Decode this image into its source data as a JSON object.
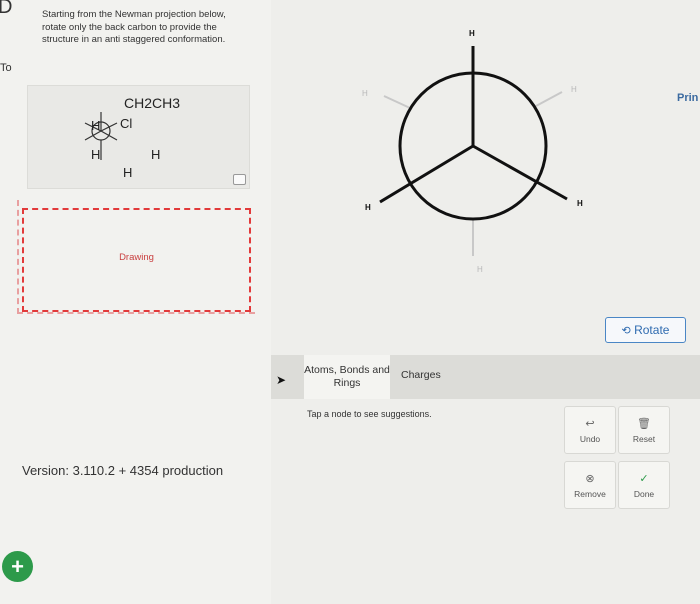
{
  "instructions": "Starting from the Newman projection below, rotate only the back carbon to provide the structure in an anti staggered conformation.",
  "given_projection": {
    "top": "CH2CH3",
    "upper_left": "H",
    "upper_right": "Cl",
    "lower_left": "H",
    "lower_right": "H",
    "bottom": "H"
  },
  "drawing_label": "Drawing",
  "version": "Version: 3.110.2 + 4354 production",
  "edge_text": {
    "top": "D",
    "mid": "To",
    "right": "Prin"
  },
  "newman_canvas": {
    "front_labels": {
      "top": "H",
      "lower_left": "H",
      "lower_right": "H"
    },
    "back_labels": {
      "upper_left": "H",
      "upper_right": "H",
      "bottom": "H"
    }
  },
  "rotate_label": "Rotate",
  "tabs": {
    "atoms": "Atoms, Bonds and Rings",
    "charges": "Charges"
  },
  "hint": "Tap a node to see suggestions.",
  "actions": {
    "undo": "Undo",
    "reset": "Reset",
    "remove": "Remove",
    "done": "Done"
  },
  "colors": {
    "accent": "#2f6bb0",
    "drawing_border": "#e23a3a",
    "add_button": "#2d9a4a"
  }
}
